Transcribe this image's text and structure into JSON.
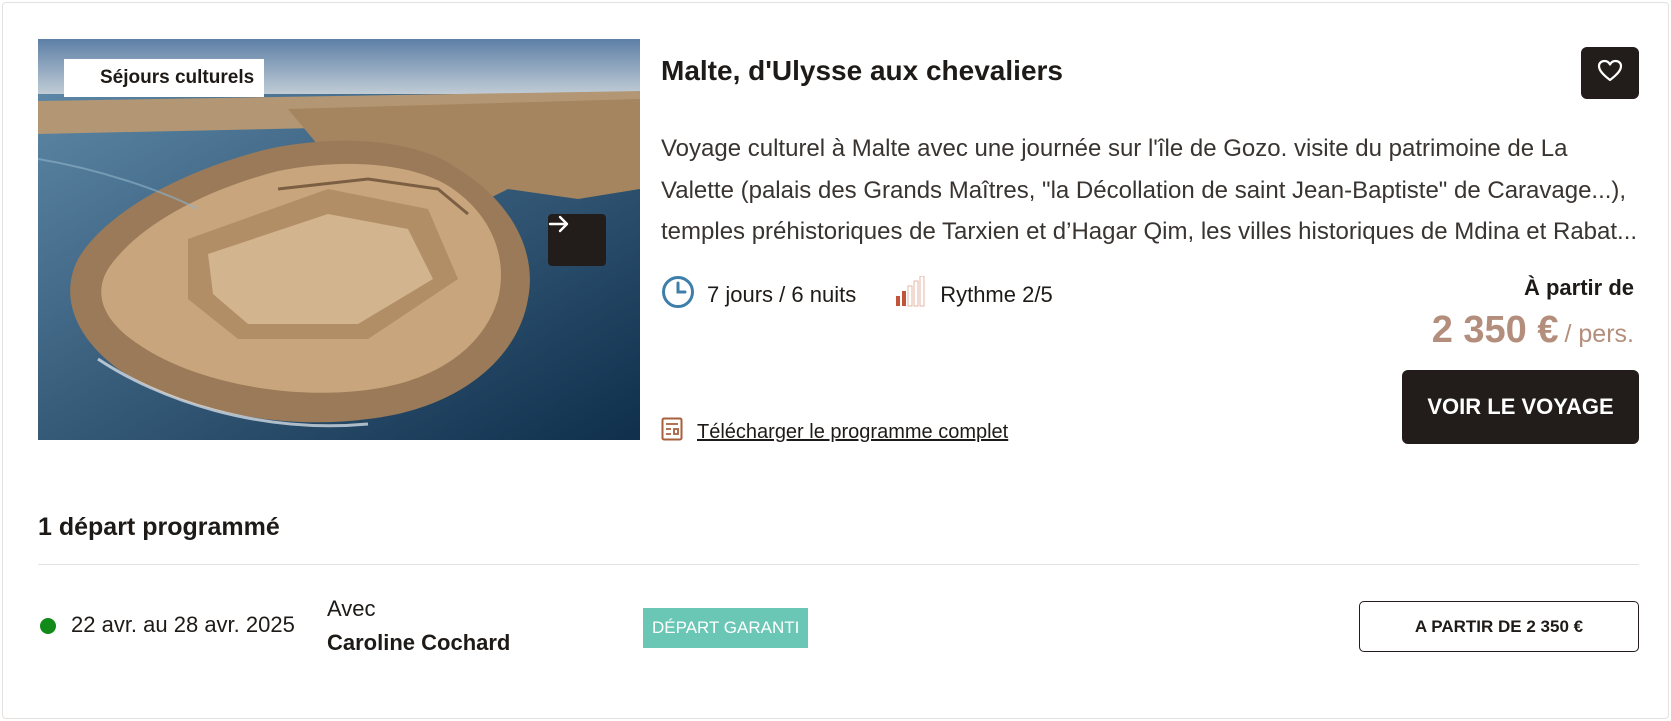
{
  "card": {
    "category": "Séjours culturels",
    "title": "Malte, d'Ulysse aux chevaliers",
    "description": "Voyage culturel à Malte avec une journée sur l'île de Gozo. visite du patrimoine de La Valette (palais des Grands Maîtres, \"la Décollation de saint Jean-Baptiste\" de Caravage...), temples préhistoriques de Tarxien et d’Hagar Qim, les villes historiques de Mdina et Rabat...",
    "duration": "7 jours / 6 nuits",
    "rhythm": "Rythme 2/5",
    "rhythm_level": 2,
    "rhythm_max": 5,
    "price_label": "À partir de",
    "price_amount": "2 350 €",
    "price_unit": "/ pers.",
    "cta_label": "VOIR LE VOYAGE",
    "download_label": "Télécharger le programme complet",
    "icons": {
      "next": "arrow-right-icon",
      "favorite": "heart-icon",
      "duration": "clock-icon",
      "rhythm": "rhythm-bars-icon",
      "download": "document-icon"
    }
  },
  "departures": {
    "title": "1 départ programmé",
    "items": [
      {
        "dates": "22 avr. au 28 avr. 2025",
        "with_label": "Avec",
        "guide": "Caroline Cochard",
        "status": "DÉPART GARANTI",
        "button_label": "A PARTIR DE 2 350 €"
      }
    ]
  },
  "colors": {
    "dark": "#221d1a",
    "price": "#b48e7c",
    "badge": "#6ac7b5",
    "status_dot": "#128a1a",
    "clock": "#3d7fa8",
    "rhythm": "#c0553a"
  }
}
